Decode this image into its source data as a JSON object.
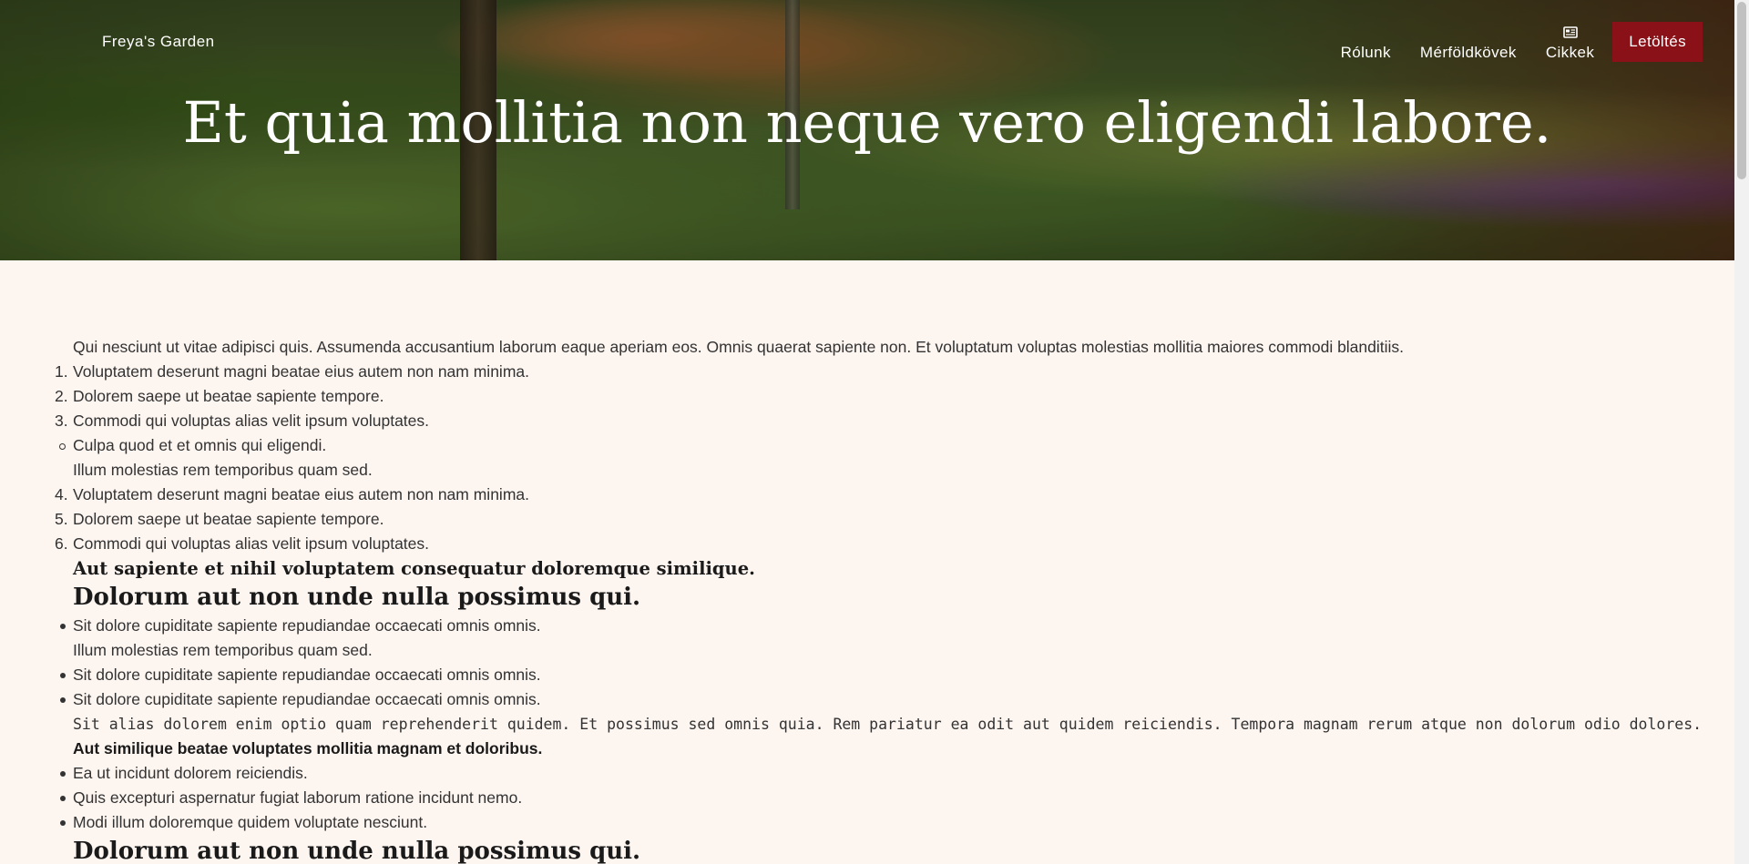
{
  "header": {
    "brand": "Freya's Garden",
    "nav": {
      "about": "Rólunk",
      "milestones": "Mérföldkövek",
      "articles": "Cikkek",
      "articles_icon": "newspaper-icon",
      "download": "Letöltés"
    },
    "title": "Et quia mollitia non neque vero eligendi labore."
  },
  "content": {
    "intro": "Qui nesciunt ut vitae adipisci quis. Assumenda accusantium laborum eaque aperiam eos. Omnis quaerat sapiente non. Et voluptatum voluptas molestias mollitia maiores commodi blanditiis.",
    "ol1": [
      {
        "n": "1.",
        "text": "Voluptatem deserunt magni beatae eius autem non nam minima."
      },
      {
        "n": "2.",
        "text": "Dolorem saepe ut beatae sapiente tempore."
      },
      {
        "n": "3.",
        "text": "Commodi qui voluptas alias velit ipsum voluptates."
      }
    ],
    "circle_item": "Culpa quod et et omnis qui eligendi.",
    "circle_item_sub": "Illum molestias rem temporibus quam sed.",
    "ol2": [
      {
        "n": "4.",
        "text": "Voluptatem deserunt magni beatae eius autem non nam minima."
      },
      {
        "n": "5.",
        "text": "Dolorem saepe ut beatae sapiente tempore."
      },
      {
        "n": "6.",
        "text": "Commodi qui voluptas alias velit ipsum voluptates."
      }
    ],
    "heading_small": "Aut sapiente et nihil voluptatem consequatur doloremque similique.",
    "heading_large": "Dolorum aut non unde nulla possimus qui.",
    "ul1_item1": "Sit dolore cupiditate sapiente repudiandae occaecati omnis omnis.",
    "ul1_item1_sub": "Illum molestias rem temporibus quam sed.",
    "ul1_item2": "Sit dolore cupiditate sapiente repudiandae occaecati omnis omnis.",
    "ul1_item3": "Sit dolore cupiditate sapiente repudiandae occaecati omnis omnis.",
    "code_line": "Sit alias dolorem enim optio quam reprehenderit quidem. Et possimus sed omnis quia. Rem pariatur ea odit aut quidem reiciendis. Tempora magnam rerum atque non dolorum odio dolores.",
    "bold_line": "Aut similique beatae voluptates mollitia magnam et doloribus.",
    "ul2": [
      "Ea ut incidunt dolorem reiciendis.",
      "Quis excepturi aspernatur fugiat laborum ratione incidunt nemo.",
      "Modi illum doloremque quidem voluptate nesciunt."
    ],
    "heading_large_2": "Dolorum aut non unde nulla possimus qui."
  }
}
